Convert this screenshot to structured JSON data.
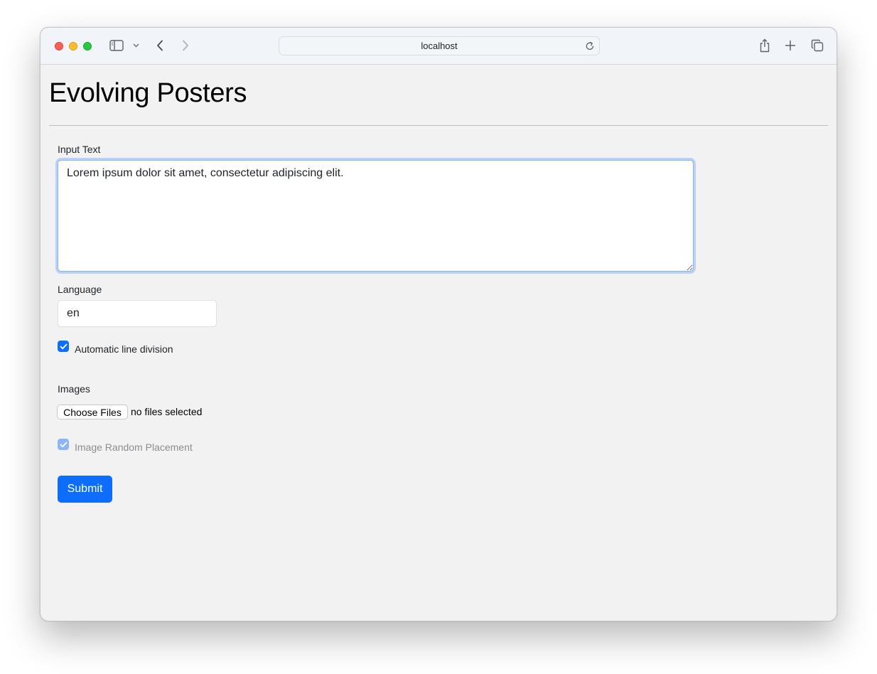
{
  "browser": {
    "address": "localhost"
  },
  "page": {
    "title": "Evolving Posters"
  },
  "form": {
    "input_text_label": "Input Text",
    "input_text_value": "Lorem ipsum dolor sit amet, consectetur adipiscing elit.",
    "language_label": "Language",
    "language_value": "en",
    "auto_line_division_label": "Automatic line division",
    "auto_line_division_checked": true,
    "images_label": "Images",
    "choose_files_label": "Choose Files",
    "file_status": "no files selected",
    "image_random_placement_label": "Image Random Placement",
    "image_random_placement_checked": true,
    "image_random_placement_disabled": true,
    "submit_label": "Submit"
  },
  "colors": {
    "primary": "#0d6efd",
    "focus_border": "#86b7fe",
    "page_background": "#f2f2f2",
    "toolbar_background": "#f1f5f9"
  },
  "icons": [
    "sidebar-icon",
    "chevron-down-icon",
    "back-icon",
    "forward-icon",
    "reload-icon",
    "share-icon",
    "new-tab-icon",
    "tabs-overview-icon",
    "checkmark-icon"
  ]
}
